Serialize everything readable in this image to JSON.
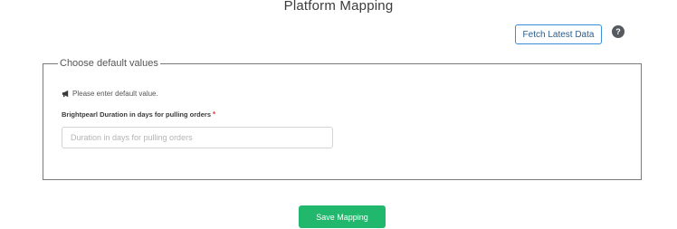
{
  "header": {
    "title": "Platform Mapping",
    "fetch_label": "Fetch Latest Data",
    "help_icon": "question-circle-icon",
    "help_glyph": "?"
  },
  "defaults": {
    "legend": "Choose default values",
    "notice_icon": "megaphone-icon",
    "notice": "Please enter default value.",
    "field_label": "Brightpearl Duration in days for pulling orders",
    "required_marker": "*",
    "input_placeholder": "Duration in days for pulling orders",
    "input_value": ""
  },
  "footer": {
    "save_label": "Save Mapping"
  },
  "colors": {
    "accent_green": "#21b76c",
    "accent_blue": "#3b8ed8",
    "required_red": "#e53935"
  }
}
